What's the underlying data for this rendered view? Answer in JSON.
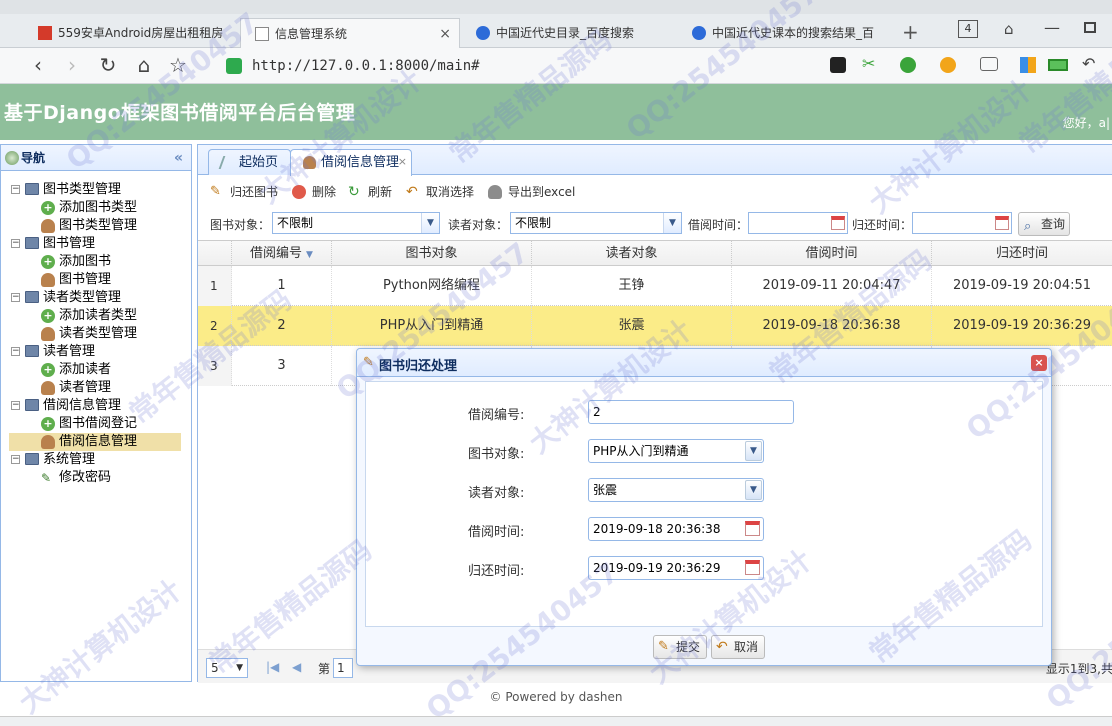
{
  "browser": {
    "tabs": [
      {
        "label": "559安卓Android房屋出租租房"
      },
      {
        "label": "信息管理系统",
        "active": true
      },
      {
        "label": "中国近代史目录_百度搜索"
      },
      {
        "label": "中国近代史课本的搜索结果_百"
      }
    ],
    "tab_count": "4",
    "address": "http://127.0.0.1:8000/main#"
  },
  "app": {
    "title": "基于Django框架图书借阅平台后台管理",
    "greeting": "您好，a|"
  },
  "sidebar": {
    "title": "导航",
    "groups": [
      {
        "label": "图书类型管理",
        "children": [
          "添加图书类型",
          "图书类型管理"
        ]
      },
      {
        "label": "图书管理",
        "children": [
          "添加图书",
          "图书管理"
        ]
      },
      {
        "label": "读者类型管理",
        "children": [
          "添加读者类型",
          "读者类型管理"
        ]
      },
      {
        "label": "读者管理",
        "children": [
          "添加读者",
          "读者管理"
        ]
      },
      {
        "label": "借阅信息管理",
        "children": [
          "图书借阅登记",
          "借阅信息管理"
        ]
      },
      {
        "label": "系统管理",
        "children": [
          "修改密码"
        ]
      }
    ]
  },
  "main": {
    "tabs": [
      {
        "label": "起始页"
      },
      {
        "label": "借阅信息管理"
      }
    ],
    "toolbar": {
      "return_label": "归还图书",
      "delete_label": "删除",
      "refresh_label": "刷新",
      "deselect_label": "取消选择",
      "export_label": "导出到excel"
    },
    "filters": {
      "book_label": "图书对象：",
      "book_value": "不限制",
      "reader_label": "读者对象：",
      "reader_value": "不限制",
      "borrow_time_label": "借阅时间：",
      "return_time_label": "归还时间：",
      "query_label": "查询"
    },
    "grid": {
      "columns": [
        "借阅编号",
        "图书对象",
        "读者对象",
        "借阅时间",
        "归还时间"
      ],
      "rows": [
        {
          "rownum": "1",
          "cells": [
            "1",
            "Python网络编程",
            "王铮",
            "2019-09-11 20:04:47",
            "2019-09-19 20:04:51"
          ]
        },
        {
          "rownum": "2",
          "cells": [
            "2",
            "PHP从入门到精通",
            "张震",
            "2019-09-18 20:36:38",
            "2019-09-19 20:36:29"
          ]
        },
        {
          "rownum": "3",
          "cells": [
            "3",
            "",
            "",
            "",
            ""
          ]
        }
      ]
    },
    "pager": {
      "page_size": "5",
      "page_label": "第",
      "page_value": "1",
      "info": "显示1到3,共"
    }
  },
  "dialog": {
    "title": "图书归还处理",
    "fields": [
      {
        "label": "借阅编号:",
        "value": "2"
      },
      {
        "label": "图书对象:",
        "value": "PHP从入门到精通"
      },
      {
        "label": "读者对象:",
        "value": "张震"
      },
      {
        "label": "借阅时间:",
        "value": "2019-09-18 20:36:38"
      },
      {
        "label": "归还时间:",
        "value": "2019-09-19 20:36:29"
      }
    ],
    "submit_label": "提交",
    "cancel_label": "取消"
  },
  "footer": "© Powered by dashen",
  "watermark": [
    "QQ:254540457",
    "大神计算机设计",
    "常年售精品源码"
  ],
  "colors": {
    "header": "#8fbf9b",
    "selected_row": "#fbec88",
    "panel_border": "#95b8e7"
  }
}
